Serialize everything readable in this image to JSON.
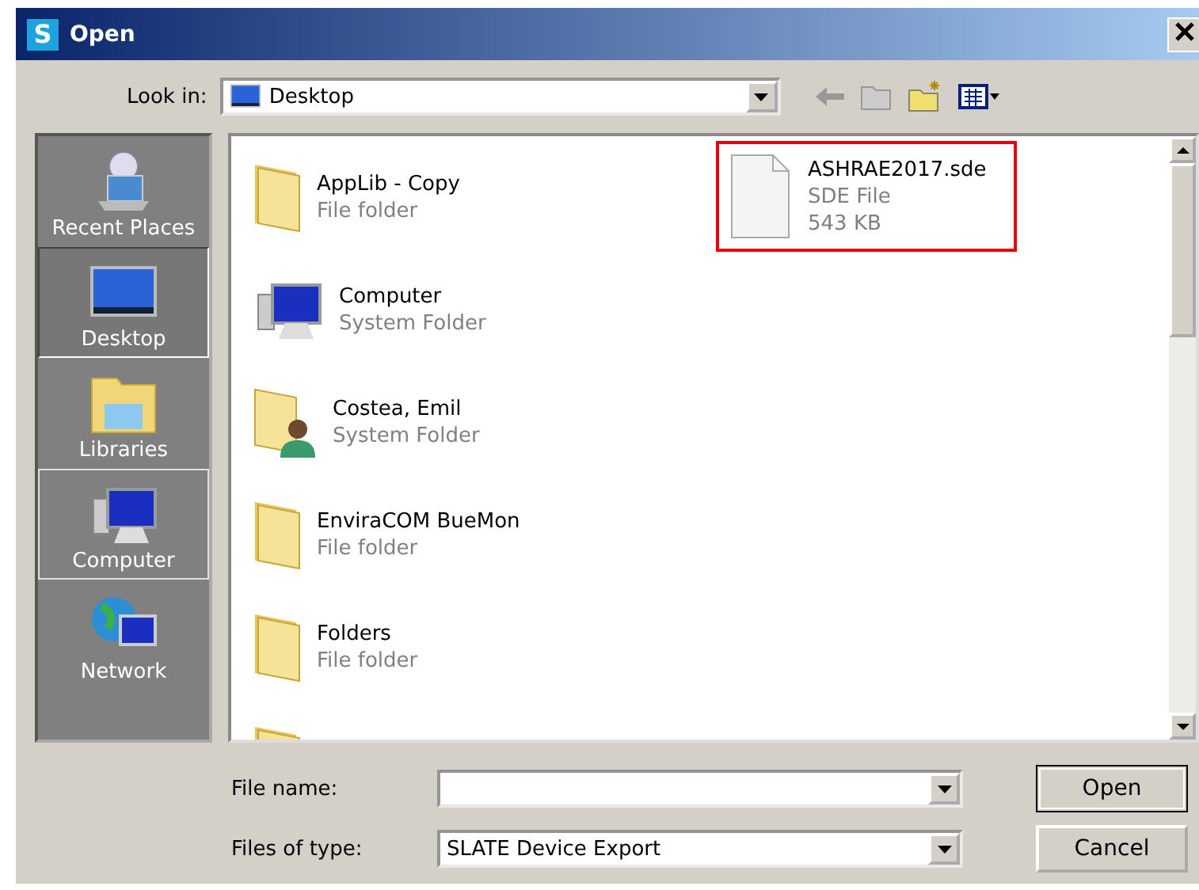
{
  "window": {
    "title": "Open",
    "app_letter": "S"
  },
  "look_in": {
    "label": "Look in:",
    "value": "Desktop"
  },
  "sidebar": {
    "items": [
      {
        "label": "Recent Places",
        "kind": "recent",
        "selected": false,
        "hovered": false
      },
      {
        "label": "Desktop",
        "kind": "desktop",
        "selected": true,
        "hovered": false
      },
      {
        "label": "Libraries",
        "kind": "libraries",
        "selected": false,
        "hovered": false
      },
      {
        "label": "Computer",
        "kind": "computer",
        "selected": false,
        "hovered": true
      },
      {
        "label": "Network",
        "kind": "network",
        "selected": false,
        "hovered": false
      }
    ]
  },
  "files": [
    {
      "name": "AppLib - Copy",
      "type": "File folder",
      "kind": "folder",
      "highlighted": false
    },
    {
      "name": "Computer",
      "type": "System Folder",
      "kind": "computer",
      "highlighted": false
    },
    {
      "name": "Costea, Emil",
      "type": "System Folder",
      "kind": "user",
      "highlighted": false
    },
    {
      "name": "EnviraCOM BueMon",
      "type": "File folder",
      "kind": "folder",
      "highlighted": false
    },
    {
      "name": "Folders",
      "type": "File folder",
      "kind": "folder",
      "highlighted": false
    },
    {
      "kind": "folder",
      "highlighted": false
    },
    {
      "name": "ASHRAE2017.sde",
      "type": "SDE File",
      "size": "543 KB",
      "kind": "file",
      "highlighted": true
    }
  ],
  "file_name": {
    "label": "File name:"
  },
  "file_type": {
    "label": "Files of type:",
    "value": "SLATE Device Export"
  },
  "buttons": [
    {
      "label": "Open",
      "default": true
    },
    {
      "label": "Cancel",
      "default": false
    }
  ]
}
